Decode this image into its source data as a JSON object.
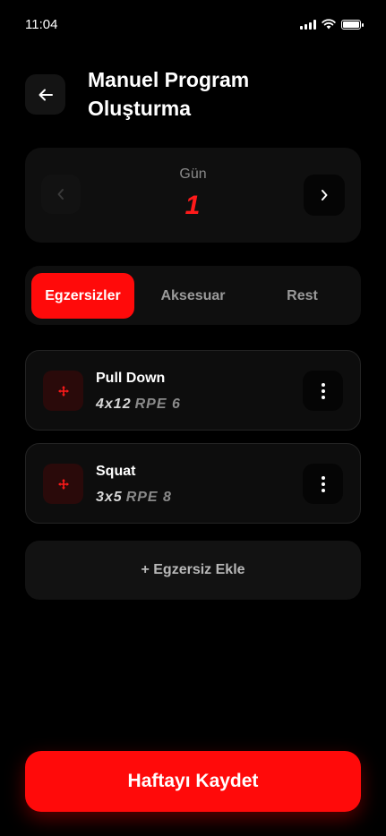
{
  "status_bar": {
    "time": "11:04"
  },
  "header": {
    "title": "Manuel Program Oluşturma",
    "back_icon": "arrow-left-icon"
  },
  "day_selector": {
    "label": "Gün",
    "value": "1"
  },
  "tabs": [
    {
      "label": "Egzersizler",
      "active": true
    },
    {
      "label": "Aksesuar",
      "active": false
    },
    {
      "label": "Rest",
      "active": false
    }
  ],
  "exercises": [
    {
      "name": "Pull Down",
      "sets": "4x12",
      "rpe": "RPE 6"
    },
    {
      "name": "Squat",
      "sets": "3x5",
      "rpe": "RPE 8"
    }
  ],
  "add_exercise_label": "+ Egzersiz Ekle",
  "save_label": "Haftayı Kaydet",
  "colors": {
    "accent": "#ff0a0a",
    "background": "#000000",
    "card": "#0f0f0f"
  }
}
